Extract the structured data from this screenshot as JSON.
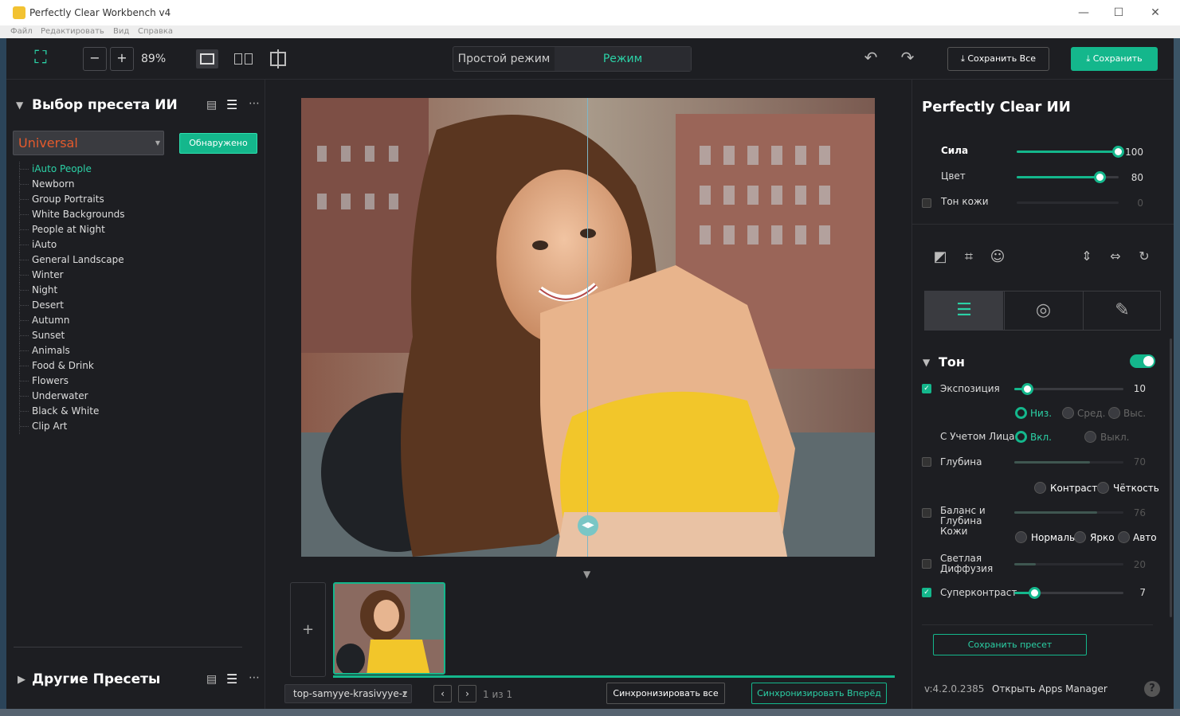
{
  "window": {
    "title": "Perfectly Clear Workbench v4",
    "controls": [
      "minimize-icon",
      "maximize-icon",
      "close-icon"
    ]
  },
  "menu": [
    "Файл",
    "Редактировать",
    "Вид",
    "Справка"
  ],
  "toolbar": {
    "zoom_out": "−",
    "zoom_in": "+",
    "zoom_level": "89%",
    "mode_simple": "Простой режим",
    "mode_edit": "Режим редактирования",
    "save_all": "Сохранить Все",
    "save": "Сохранить"
  },
  "left": {
    "title": "Выбор пресета ИИ",
    "dropdown_value": "Universal",
    "detected_label": "Обнаружено",
    "presets": [
      "iAuto People",
      "Newborn",
      "Group Portraits",
      "White Backgrounds",
      "People at Night",
      "iAuto",
      "General Landscape",
      "Winter",
      "Night",
      "Desert",
      "Autumn",
      "Sunset",
      "Animals",
      "Food & Drink",
      "Flowers",
      "Underwater",
      "Black & White",
      "Clip Art"
    ],
    "active_preset": "iAuto People",
    "other_title": "Другие Пресеты"
  },
  "center": {
    "add_label": "+",
    "file_name": "top-samyye-krasivyye-z",
    "page_count": "1 из 1",
    "sync_all": "Синхронизировать все",
    "sync_forward": "Синхронизировать Вперёд"
  },
  "right": {
    "title": "Perfectly Clear ИИ",
    "strength_label": "Сила",
    "strength_value": "100",
    "color_label": "Цвет",
    "color_value": "80",
    "skin_label": "Тон кожи",
    "skin_value": "0",
    "tone_title": "Тон",
    "exposure_label": "Экспозиция",
    "exposure_value": "10",
    "low": "Низ.",
    "mid": "Сред.",
    "high": "Выс.",
    "face_label": "С Учетом Лица",
    "on": "Вкл.",
    "off": "Выкл.",
    "depth_label": "Глубина",
    "depth_value": "70",
    "contrast": "Контраст",
    "clarity": "Чёткость",
    "skin_balance_label": "Баланс и Глубина Кожи",
    "skin_balance_value": "76",
    "normal": "Нормаль",
    "bright": "Ярко",
    "auto": "Авто",
    "diffusion_label": "Светлая Диффузия",
    "diffusion_value": "20",
    "supercontrast_label": "Суперконтраст",
    "supercontrast_value": "7",
    "save_preset": "Сохранить пресет",
    "version": "v:4.2.0.2385",
    "apps_manager": "Открыть Apps Manager",
    "help": "?"
  },
  "colors": {
    "accent": "#14b78c",
    "accent_text": "#2bd1a6",
    "dropdown_text": "#e55a2c",
    "panel_bg": "#1d1e22"
  },
  "sliders": {
    "strength": 1.0,
    "color": 0.8,
    "skin": 0.0,
    "exposure": 0.1,
    "depth": 0.7,
    "skin_balance": 0.76,
    "diffusion": 0.2,
    "supercontrast": 0.17
  }
}
